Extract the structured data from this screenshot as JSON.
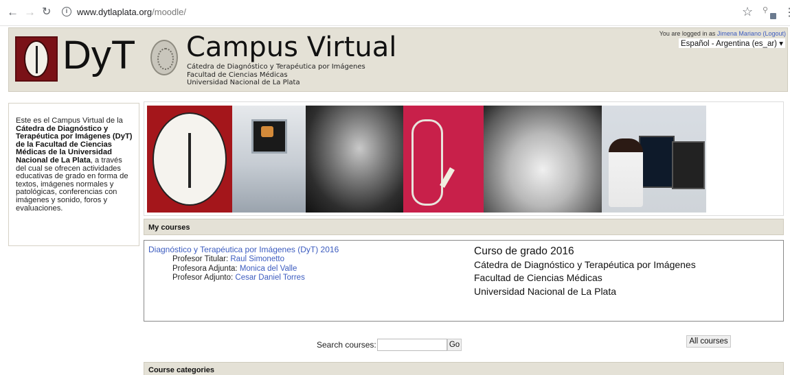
{
  "browser": {
    "url_host": "www.dytlaplata.org",
    "url_path": "/moodle/",
    "icons": [
      "back-arrow-icon",
      "forward-arrow-icon",
      "reload-icon",
      "info-icon",
      "star-icon",
      "extension-icon",
      "menu-icon"
    ]
  },
  "header": {
    "logo_text": "DyT",
    "title": "Campus Virtual",
    "subtitle_lines": [
      "Cátedra de Diagnóstico y Terapéutica por Imágenes",
      "Facultad de Ciencias Médicas",
      "Universidad Nacional de La Plata"
    ],
    "login_prefix": "You are logged in as ",
    "user_name": "Jimena Mariano",
    "logout_label": "(Logout)",
    "language": "Español - Argentina (es_ar)"
  },
  "sidebar": {
    "intro": {
      "part1": "Este es el Campus Virtual de la ",
      "bold": "Cátedra de Diagnóstico y Terapéutica por Imágenes (DyT) de la Facultad de Ciencias Médicas de la Universidad Nacional de La Plata",
      "part2": ", a través del cual se ofrecen actividades educativas de grado en forma de textos, imágenes normales y patológicas, conferencias con imágenes y sonido, foros y evaluaciones."
    }
  },
  "my_courses": {
    "heading": "My courses",
    "course": {
      "name": "Diagnóstico y Terapéutica por Imágenes (DyT) 2016",
      "teachers": [
        {
          "role": "Profesor Titular: ",
          "name": "Raul Simonetto"
        },
        {
          "role": "Profesora Adjunta: ",
          "name": "Monica del Valle"
        },
        {
          "role": "Profesor Adjunto: ",
          "name": "Cesar Daniel Torres"
        }
      ],
      "summary": [
        "Curso de grado 2016",
        "Cátedra de Diagnóstico y Terapéutica por Imágenes",
        "Facultad de Ciencias Médicas",
        "Universidad Nacional de La Plata"
      ]
    }
  },
  "search": {
    "label": "Search courses: ",
    "value": "",
    "go_label": "Go",
    "all_courses_label": "All courses"
  },
  "categories": {
    "heading": "Course categories"
  },
  "colors": {
    "header_bg": "#e4e1d6",
    "link": "#3b5bbf",
    "logo_red": "#7a1217"
  }
}
